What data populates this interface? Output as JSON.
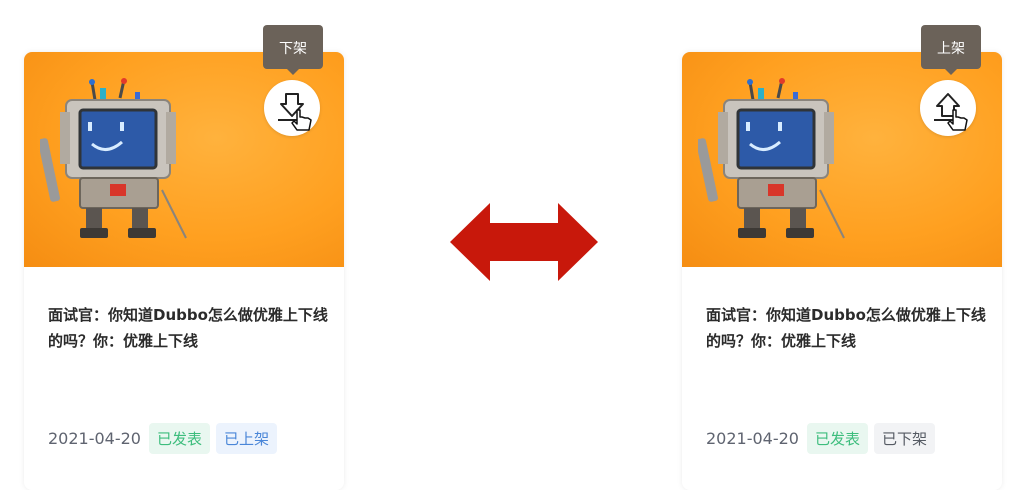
{
  "cards": [
    {
      "title": "面试官：你知道Dubbo怎么做优雅上下线的吗？你：优雅上下线",
      "date": "2021-04-20",
      "tags": [
        "已发表",
        "已上架"
      ],
      "tooltip": "下架",
      "action_icon": "unpublish-down-icon"
    },
    {
      "title": "面试官：你知道Dubbo怎么做优雅上下线的吗？你：优雅上下线",
      "date": "2021-04-20",
      "tags": [
        "已发表",
        "已下架"
      ],
      "tooltip": "上架",
      "action_icon": "publish-up-icon"
    }
  ],
  "colors": {
    "cover_orange": "#ffa020",
    "swap_arrow_red": "#c8180b",
    "tag_green": "#3dbd7d",
    "tag_blue": "#4a86d8",
    "tag_gray": "#555a63",
    "tooltip_bg": "#6b6259"
  }
}
